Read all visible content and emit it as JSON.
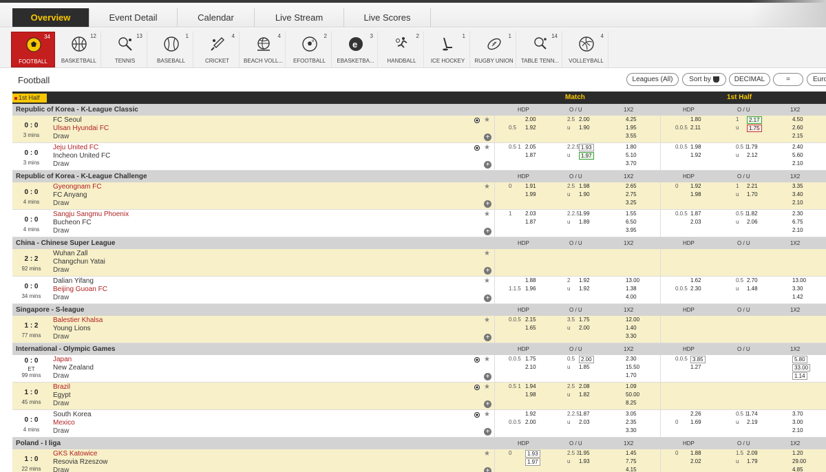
{
  "nav": {
    "tabs": [
      "Overview",
      "Event Detail",
      "Calendar",
      "Live Stream",
      "Live Scores"
    ],
    "active_index": 0
  },
  "sports": [
    {
      "name": "FOOTBALL",
      "count": "34",
      "icon": "football-icon"
    },
    {
      "name": "BASKETBALL",
      "count": "12",
      "icon": "basketball-icon"
    },
    {
      "name": "TENNIS",
      "count": "13",
      "icon": "tennis-icon"
    },
    {
      "name": "BASEBALL",
      "count": "1",
      "icon": "baseball-icon"
    },
    {
      "name": "CRICKET",
      "count": "4",
      "icon": "cricket-icon"
    },
    {
      "name": "BEACH VOLL...",
      "count": "4",
      "icon": "beach-volleyball-icon"
    },
    {
      "name": "EFOOTBALL",
      "count": "2",
      "icon": "efootball-icon"
    },
    {
      "name": "EBASKETBA...",
      "count": "3",
      "icon": "ebasketball-icon"
    },
    {
      "name": "HANDBALL",
      "count": "2",
      "icon": "handball-icon"
    },
    {
      "name": "ICE HOCKEY",
      "count": "1",
      "icon": "ice-hockey-icon"
    },
    {
      "name": "RUGBY UNION",
      "count": "1",
      "icon": "rugby-icon"
    },
    {
      "name": "TABLE TENN...",
      "count": "14",
      "icon": "table-tennis-icon"
    },
    {
      "name": "VOLLEYBALL",
      "count": "4",
      "icon": "volleyball-icon"
    }
  ],
  "page": {
    "title": "Football",
    "buttons": {
      "leagues": "Leagues (All)",
      "sort": "Sort by",
      "decimal": "DECIMAL",
      "equals": "=",
      "euro": "Euro"
    }
  },
  "header": {
    "first_half_tag": "1st Half",
    "match": "Match",
    "first_half": "1st Half"
  },
  "sub_headers": [
    "HDP",
    "O / U",
    "1X2",
    "HDP",
    "O / U",
    "1X2"
  ],
  "colors": {
    "accent": "#f7c600",
    "brand_red": "#c41e1e",
    "row_yellow": "#f7f0c9",
    "dark": "#2b2b2b"
  },
  "leagues": [
    {
      "name": "Republic of Korea - K-League Classic",
      "matches": [
        {
          "score": "0 : 0",
          "time": "3 mins",
          "team1": "FC Seoul",
          "team1_red": false,
          "team2": "Ulsan Hyundai FC",
          "team2_red": true,
          "draw": "Draw",
          "live": true,
          "bg": "y",
          "odds": {
            "hdp": {
              "l1": "",
              "v1": "2.00",
              "l2": "0.5",
              "v2": "1.92"
            },
            "ou": {
              "l1": "2.5",
              "v1": "2.00",
              "l2": "u",
              "v2": "1.90"
            },
            "x12": [
              "4.25",
              "1.95",
              "3.55"
            ],
            "h_hdp": {
              "l1": "",
              "v1": "1.80",
              "l2": "0.0.5",
              "v2": "2.11"
            },
            "h_ou": {
              "l1": "1",
              "v1": "2.17",
              "b1": "g",
              "l2": "u",
              "v2": "1.75",
              "b2": "r"
            },
            "h_x12": [
              "4.50",
              "2.60",
              "2.15"
            ]
          }
        },
        {
          "score": "0 : 0",
          "time": "3 mins",
          "team1": "Jeju United FC",
          "team1_red": true,
          "team2": "Incheon United FC",
          "team2_red": false,
          "draw": "Draw",
          "live": true,
          "bg": "w",
          "odds": {
            "hdp": {
              "l1": "0.5 1",
              "v1": "2.05",
              "l2": "",
              "v2": "1.87"
            },
            "ou": {
              "l1": "2.2.5",
              "v1": "1.93",
              "b1": "n",
              "l2": "u",
              "v2": "1.97",
              "b2": "g"
            },
            "x12": [
              "1.80",
              "5.10",
              "3.70"
            ],
            "h_hdp": {
              "l1": "0.0.5",
              "v1": "1.98",
              "l2": "",
              "v2": "1.92"
            },
            "h_ou": {
              "l1": "0.5 1",
              "v1": "1.79",
              "l2": "u",
              "v2": "2.12"
            },
            "h_x12": [
              "2.40",
              "5.60",
              "2.10"
            ]
          }
        }
      ]
    },
    {
      "name": "Republic of Korea - K-League Challenge",
      "matches": [
        {
          "score": "0 : 0",
          "time": "4 mins",
          "team1": "Gyeongnam FC",
          "team1_red": true,
          "team2": "FC Anyang",
          "team2_red": false,
          "draw": "Draw",
          "live": false,
          "bg": "y",
          "odds": {
            "hdp": {
              "l1": "0",
              "v1": "1.91",
              "l2": "",
              "v2": "1.99"
            },
            "ou": {
              "l1": "2.5",
              "v1": "1.98",
              "l2": "u",
              "v2": "1.90"
            },
            "x12": [
              "2.65",
              "2.75",
              "3.25"
            ],
            "h_hdp": {
              "l1": "0",
              "v1": "1.92",
              "l2": "",
              "v2": "1.98"
            },
            "h_ou": {
              "l1": "1",
              "v1": "2.21",
              "l2": "u",
              "v2": "1.70"
            },
            "h_x12": [
              "3.35",
              "3.40",
              "2.10"
            ]
          }
        },
        {
          "score": "0 : 0",
          "time": "4 mins",
          "team1": "Sangju Sangmu Phoenix",
          "team1_red": true,
          "team2": "Bucheon FC",
          "team2_red": false,
          "draw": "Draw",
          "live": false,
          "bg": "w",
          "odds": {
            "hdp": {
              "l1": "1",
              "v1": "2.03",
              "l2": "",
              "v2": "1.87"
            },
            "ou": {
              "l1": "2.2.5",
              "v1": "1.99",
              "l2": "u",
              "v2": "1.89"
            },
            "x12": [
              "1.55",
              "6.50",
              "3.95"
            ],
            "h_hdp": {
              "l1": "0.0.5",
              "v1": "1.87",
              "l2": "",
              "v2": "2.03"
            },
            "h_ou": {
              "l1": "0.5 1",
              "v1": "1.82",
              "l2": "u",
              "v2": "2.06"
            },
            "h_x12": [
              "2.30",
              "6.75",
              "2.10"
            ]
          }
        }
      ]
    },
    {
      "name": "China - Chinese Super League",
      "matches": [
        {
          "score": "2 : 2",
          "time": "92 mins",
          "team1": "Wuhan Zall",
          "team1_red": false,
          "team2": "Changchun Yatai",
          "team2_red": false,
          "draw": "Draw",
          "live": false,
          "bg": "y",
          "odds": null
        },
        {
          "score": "0 : 0",
          "time": "34 mins",
          "team1": "Dalian Yifang",
          "team1_red": false,
          "team2": "Beijing Guoan FC",
          "team2_red": true,
          "draw": "Draw",
          "live": false,
          "bg": "w",
          "odds": {
            "hdp": {
              "l1": "",
              "v1": "1.88",
              "l2": "1.1.5",
              "v2": "1.96"
            },
            "ou": {
              "l1": "2",
              "v1": "1.92",
              "l2": "u",
              "v2": "1.92"
            },
            "x12": [
              "13.00",
              "1.38",
              "4.00"
            ],
            "h_hdp": {
              "l1": "",
              "v1": "1.62",
              "l2": "0.0.5",
              "v2": "2.30"
            },
            "h_ou": {
              "l1": "0.5",
              "v1": "2.70",
              "l2": "u",
              "v2": "1.48"
            },
            "h_x12": [
              "13.00",
              "3.30",
              "1.42"
            ]
          }
        }
      ]
    },
    {
      "name": "Singapore - S-league",
      "matches": [
        {
          "score": "1 : 2",
          "time": "77 mins",
          "team1": "Balestier Khalsa",
          "team1_red": true,
          "team2": "Young Lions",
          "team2_red": false,
          "draw": "Draw",
          "live": false,
          "bg": "y",
          "odds": {
            "hdp": {
              "l1": "0.0.5",
              "v1": "2.15",
              "l2": "",
              "v2": "1.65"
            },
            "ou": {
              "l1": "3.5",
              "v1": "1.75",
              "l2": "u",
              "v2": "2.00"
            },
            "x12": [
              "12.00",
              "1.40",
              "3.30"
            ],
            "h_hdp": null,
            "h_ou": null,
            "h_x12": null
          }
        }
      ]
    },
    {
      "name": "International - Olympic Games",
      "matches": [
        {
          "score": "0 : 0",
          "et": "ET",
          "time": "99 mins",
          "team1": "Japan",
          "team1_red": true,
          "team2": "New Zealand",
          "team2_red": false,
          "draw": "Draw",
          "live": true,
          "bg": "w",
          "odds": {
            "hdp": {
              "l1": "0.0.5",
              "v1": "1.75",
              "l2": "",
              "v2": "2.10"
            },
            "ou": {
              "l1": "0.5",
              "v1": "2.00",
              "b1": "n",
              "l2": "u",
              "v2": "1.85"
            },
            "x12": [
              "2.30",
              "15.50",
              "1.70"
            ],
            "h_hdp": {
              "l1": "0.0.5",
              "v1": "3.85",
              "b1": "n",
              "l2": "",
              "v2": "1.27"
            },
            "h_ou": null,
            "h_x12": [
              "5.80",
              "33.00",
              "1.14"
            ],
            "h_x12_box": true
          }
        },
        {
          "score": "1 : 0",
          "time": "45 mins",
          "team1": "Brazil",
          "team1_red": true,
          "team2": "Egypt",
          "team2_red": false,
          "draw": "Draw",
          "live": true,
          "bg": "y",
          "odds": {
            "hdp": {
              "l1": "0.5 1",
              "v1": "1.94",
              "l2": "",
              "v2": "1.98"
            },
            "ou": {
              "l1": "2.5",
              "v1": "2.08",
              "l2": "u",
              "v2": "1.82"
            },
            "x12": [
              "1.09",
              "50.00",
              "8.25"
            ],
            "h_hdp": null,
            "h_ou": null,
            "h_x12": null
          }
        },
        {
          "score": "0 : 0",
          "time": "4 mins",
          "team1": "South Korea",
          "team1_red": false,
          "team2": "Mexico",
          "team2_red": true,
          "draw": "Draw",
          "live": true,
          "bg": "w",
          "odds": {
            "hdp": {
              "l1": "",
              "v1": "1.92",
              "l2": "0.0.5",
              "v2": "2.00"
            },
            "ou": {
              "l1": "2.2.5",
              "v1": "1.87",
              "l2": "u",
              "v2": "2.03"
            },
            "x12": [
              "3.05",
              "2.35",
              "3.30"
            ],
            "h_hdp": {
              "l1": "",
              "v1": "2.26",
              "l2": "0",
              "v2": "1.69"
            },
            "h_ou": {
              "l1": "0.5 1",
              "v1": "1.74",
              "l2": "u",
              "v2": "2.19"
            },
            "h_x12": [
              "3.70",
              "3.00",
              "2.10"
            ]
          }
        }
      ]
    },
    {
      "name": "Poland - I liga",
      "matches": [
        {
          "score": "1 : 0",
          "time": "22 mins",
          "team1": "GKS Katowice",
          "team1_red": true,
          "team2": "Resovia Rzeszow",
          "team2_red": false,
          "draw": "Draw",
          "live": false,
          "bg": "y",
          "odds": {
            "hdp": {
              "l1": "0",
              "v1": "1.93",
              "b1": "n",
              "l2": "",
              "v2": "1.97",
              "b2": "n"
            },
            "ou": {
              "l1": "2.5 3",
              "v1": "1.95",
              "l2": "u",
              "v2": "1.93"
            },
            "x12": [
              "1.45",
              "7.75",
              "4.15"
            ],
            "h_hdp": {
              "l1": "0",
              "v1": "1.88",
              "l2": "",
              "v2": "2.02"
            },
            "h_ou": {
              "l1": "1.5",
              "v1": "2.09",
              "l2": "u",
              "v2": "1.79"
            },
            "h_x12": [
              "1.20",
              "29.00",
              "4.85"
            ]
          }
        }
      ]
    }
  ]
}
